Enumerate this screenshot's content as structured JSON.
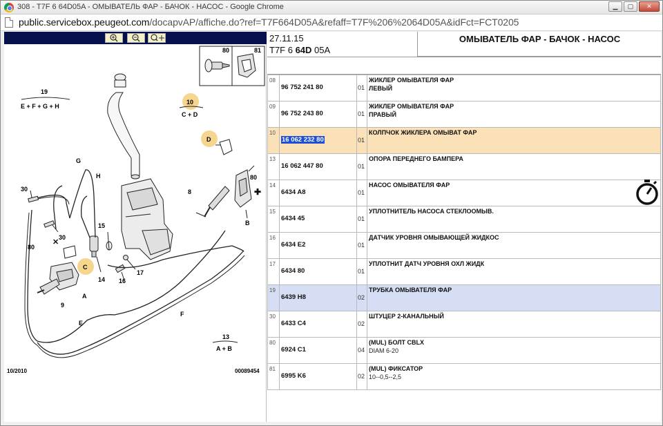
{
  "window": {
    "title": "308 - T7F 6 64D05A - ОМЫВАТЕЛЬ ФАР - БАЧОК - НАСОС - Google Chrome",
    "url_host": "public.servicebox.peugeot.com",
    "url_path": "/docapvAP/affiche.do?ref=T7F664D05A&refaff=T7F%206%2064D05A&idFct=FCT0205"
  },
  "zoom_toolbar": {
    "zoom_in_icon": "zoom-in-icon",
    "zoom_out_icon": "zoom-out-icon",
    "zoom_fit_icon": "zoom-fit-icon"
  },
  "diagram": {
    "labels": {
      "l19": "19",
      "l19_sub": "E + F + G + H",
      "l10": "10",
      "l10_sub": "C + D",
      "l13": "13",
      "l13_sub": "A + B",
      "lG": "G",
      "lH": "H",
      "l30a": "30",
      "l30b": "30",
      "l80a": "80",
      "l80b": "80",
      "l80c": "80",
      "l81": "81",
      "lC": "C",
      "lD": "D",
      "l14": "14",
      "l15": "15",
      "l16": "16",
      "l17": "17",
      "lA": "A",
      "l9": "9",
      "lE": "E",
      "lF": "F",
      "l8": "8",
      "lB": "B"
    },
    "footer_left": "10/2010",
    "footer_right": "00089454"
  },
  "header": {
    "date": "27.11.15",
    "vin_prefix": "T7F 6 ",
    "vin_bold": "64D",
    "vin_suffix": " 05A",
    "title": "ОМЫВАТЕЛЬ ФАР - БАЧОК - НАСОС"
  },
  "parts": [
    {
      "pos": "08",
      "ref": "96 752 241 80",
      "qty": "01",
      "d1": "ЖИКЛЕР ОМЫВАТЕЛЯ ФАР",
      "d2": "ЛЕВЫЙ"
    },
    {
      "pos": "09",
      "ref": "96 752 243 80",
      "qty": "01",
      "d1": "ЖИКЛЕР ОМЫВАТЕЛЯ ФАР",
      "d2": "ПРАВЫЙ"
    },
    {
      "pos": "10",
      "ref": "16 062 232 80",
      "qty": "01",
      "d1": "КОЛПЧОК ЖИКЛЕРА ОМЫВАТ ФАР",
      "d2": ""
    },
    {
      "pos": "13",
      "ref": "16 062 447 80",
      "qty": "01",
      "d1": "ОПОРА ПЕРЕДНЕГО БАМПЕРА",
      "d2": ""
    },
    {
      "pos": "14",
      "ref": "6434 A8",
      "qty": "01",
      "d1": "НАСОС ОМЫВАТЕЛЯ ФАР",
      "d2": ""
    },
    {
      "pos": "15",
      "ref": "6434 45",
      "qty": "01",
      "d1": "УПЛОТНИТЕЛЬ НАСОСА СТЕКЛООМЫВ.",
      "d2": ""
    },
    {
      "pos": "16",
      "ref": "6434 E2",
      "qty": "01",
      "d1": "ДАТЧИК УРОВНЯ ОМЫВАЮЩЕЙ ЖИДКОС",
      "d2": ""
    },
    {
      "pos": "17",
      "ref": "6434 80",
      "qty": "01",
      "d1": "УПЛОТНИТ ДАТЧ УРОВНЯ ОХЛ ЖИДК",
      "d2": ""
    },
    {
      "pos": "19",
      "ref": "6439 H8",
      "qty": "02",
      "d1": "ТРУБКА ОМЫВАТЕЛЯ ФАР",
      "d2": ""
    },
    {
      "pos": "30",
      "ref": "6433 C4",
      "qty": "02",
      "d1": "ШТУЦЕР 2-КАНАЛЬНЫЙ",
      "d2": ""
    },
    {
      "pos": "80",
      "ref": "6924 C1",
      "qty": "04",
      "d1": "(MUL) БОЛТ CBLX",
      "d2": "DIAM 6-20"
    },
    {
      "pos": "81",
      "ref": "6995 K6",
      "qty": "02",
      "d1": "(MUL) ФИКСАТОР",
      "d2": "10--0,5--2,5"
    }
  ],
  "row_colors": {
    "highlight_orange": "#fbe1b8",
    "highlight_blue": "#d5def4",
    "selection": "#1c4fd6"
  },
  "icons": {
    "stopwatch": "stopwatch-icon"
  }
}
